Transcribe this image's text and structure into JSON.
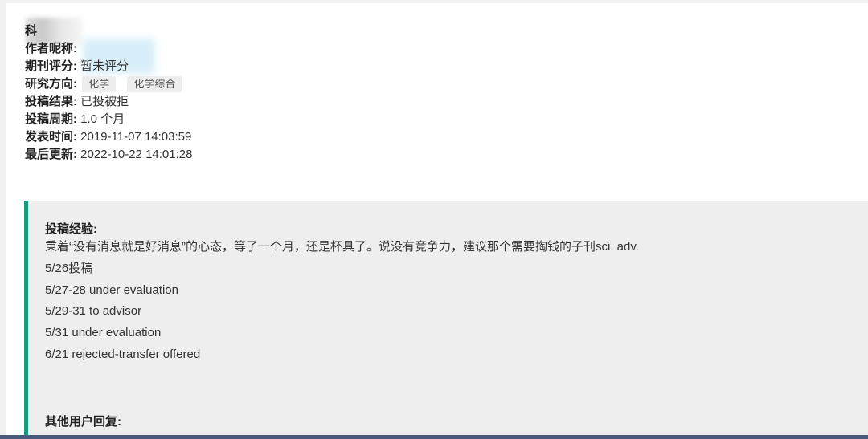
{
  "meta": {
    "title_fragment": "科",
    "author_label": "作者昵称:",
    "score_label": "期刊评分:",
    "score_value": "暂未评分",
    "field_label": "研究方向:",
    "field_tags": [
      "化学",
      "化学综合"
    ],
    "result_label": "投稿结果:",
    "result_value": "已投被拒",
    "period_label": "投稿周期:",
    "period_value": "1.0 个月",
    "published_label": "发表时间:",
    "published_value": "2019-11-07 14:03:59",
    "updated_label": "最后更新:",
    "updated_value": "2022-10-22 14:01:28"
  },
  "experience": {
    "heading": "投稿经验:",
    "lines": [
      "秉着“没有消息就是好消息”的心态，等了一个月，还是杯具了。说没有竞争力，建议那个需要掏钱的子刊sci. adv.",
      "5/26投稿",
      "5/27-28 under evaluation",
      "5/29-31 to advisor",
      "5/31 under evaluation",
      "6/21 rejected-transfer offered"
    ]
  },
  "replies": {
    "heading": "其他用户回复:"
  },
  "colors": {
    "accent_border": "#1a9a7e",
    "panel_bg": "#eeeeee",
    "tag_bg": "#ededed",
    "bottom_bar": "#4a5a7a"
  }
}
